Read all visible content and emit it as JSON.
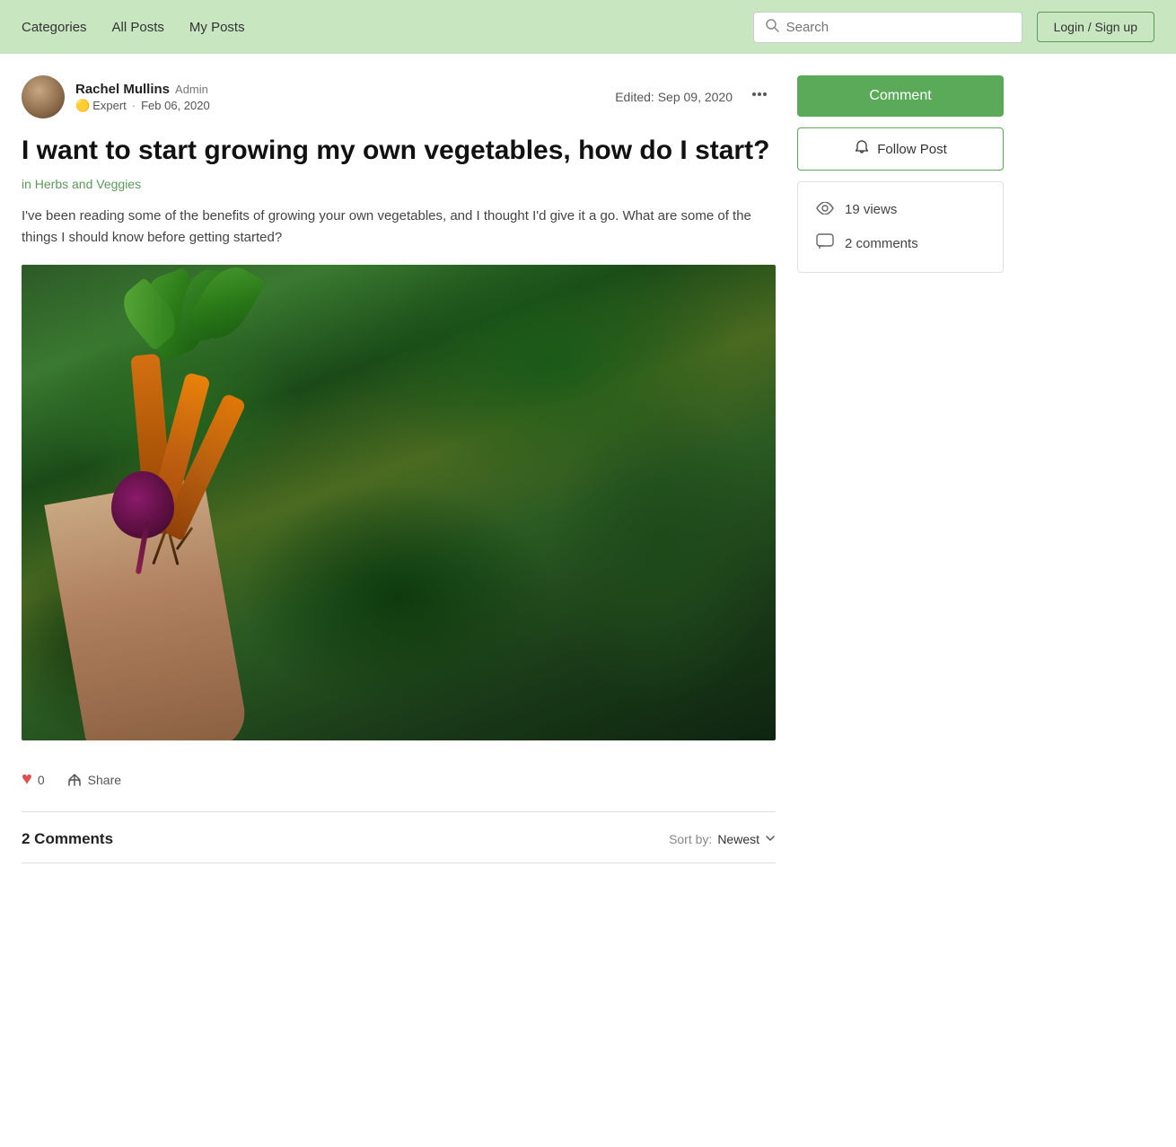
{
  "nav": {
    "categories_label": "Categories",
    "all_posts_label": "All Posts",
    "my_posts_label": "My Posts",
    "search_placeholder": "Search",
    "login_label": "Login / Sign up"
  },
  "post": {
    "author_name": "Rachel Mullins",
    "author_role": "Admin",
    "author_badge": "Expert",
    "post_date": "Feb 06, 2020",
    "edited_label": "Edited:",
    "edited_date": "Sep 09, 2020",
    "title": "I want to start growing my own vegetables, how do I start?",
    "category": "in Herbs and Veggies",
    "excerpt": "I've been reading some of the benefits of growing your own vegetables, and I thought I'd give it a go. What are some of the things I should know before getting started?",
    "like_count": "0",
    "share_label": "Share",
    "comments_count_label": "2 Comments",
    "sort_by_label": "Sort by:",
    "sort_value": "Newest"
  },
  "sidebar": {
    "comment_btn_label": "Comment",
    "follow_btn_label": "Follow Post",
    "views_count": "19 views",
    "comments_count": "2 comments"
  },
  "icons": {
    "search": "🔍",
    "heart": "♥",
    "share": "↗",
    "bell": "🔔",
    "eye": "👁",
    "comment": "💬",
    "more": "•••",
    "chevron_down": "⌄",
    "expert_dot": "🟡"
  }
}
